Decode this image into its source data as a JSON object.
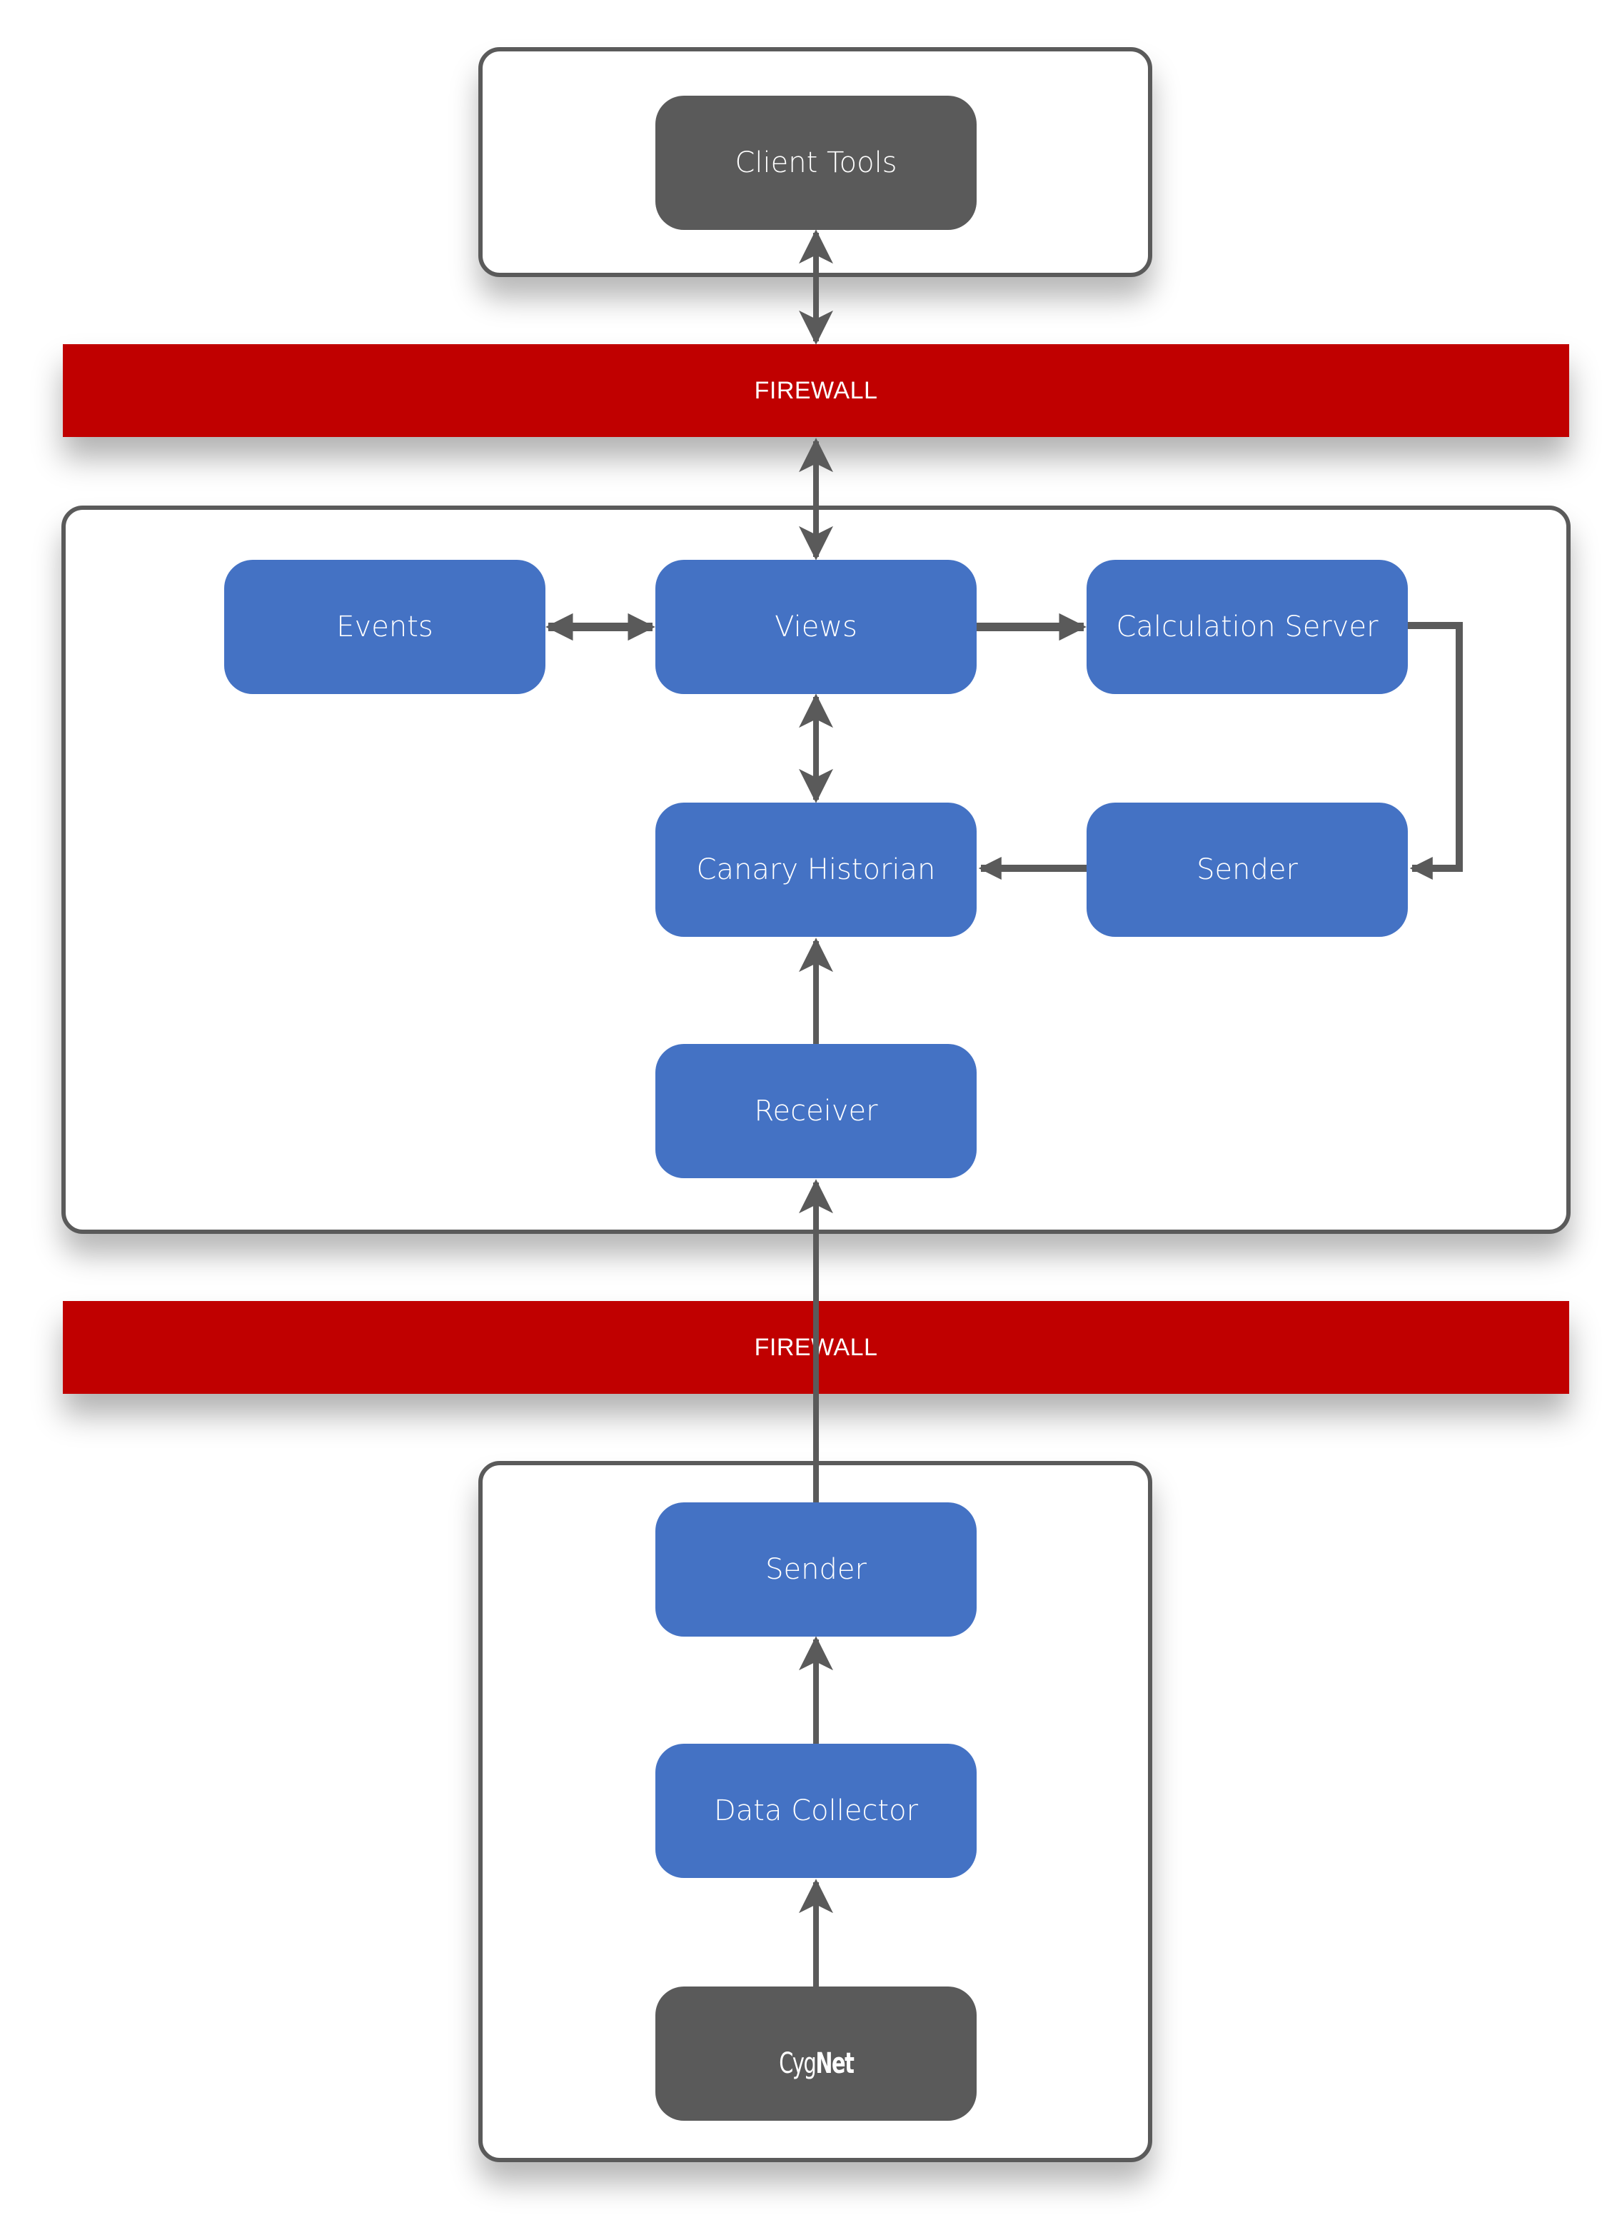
{
  "diagram": {
    "colors": {
      "firewall": "#c00000",
      "component": "#4472c4",
      "external": "#5a5a5a",
      "connector": "#5a5a5a",
      "panel_border": "#5a5a5a"
    },
    "client_zone": {
      "client_tools": "Client Tools"
    },
    "firewall_top": "FIREWALL",
    "server_zone": {
      "events": "Events",
      "views": "Views",
      "calculation_server": "Calculation Server",
      "canary_historian": "Canary Historian",
      "sender": "Sender",
      "receiver": "Receiver"
    },
    "firewall_bottom": "FIREWALL",
    "field_zone": {
      "sender": "Sender",
      "data_collector": "Data Collector",
      "cygnet_logo_light": "Cyg",
      "cygnet_logo_bold": "Net"
    },
    "connections": [
      {
        "from": "Client Tools",
        "to": "Views",
        "direction": "bidirectional",
        "via": "FIREWALL"
      },
      {
        "from": "Events",
        "to": "Views",
        "direction": "bidirectional"
      },
      {
        "from": "Views",
        "to": "Calculation Server",
        "direction": "forward"
      },
      {
        "from": "Calculation Server",
        "to": "Sender",
        "direction": "forward"
      },
      {
        "from": "Sender",
        "to": "Canary Historian",
        "direction": "forward"
      },
      {
        "from": "Views",
        "to": "Canary Historian",
        "direction": "bidirectional"
      },
      {
        "from": "Receiver",
        "to": "Canary Historian",
        "direction": "forward"
      },
      {
        "from": "Sender (field)",
        "to": "Receiver",
        "direction": "forward",
        "via": "FIREWALL"
      },
      {
        "from": "Data Collector",
        "to": "Sender (field)",
        "direction": "forward"
      },
      {
        "from": "CygNet",
        "to": "Data Collector",
        "direction": "forward"
      }
    ]
  }
}
